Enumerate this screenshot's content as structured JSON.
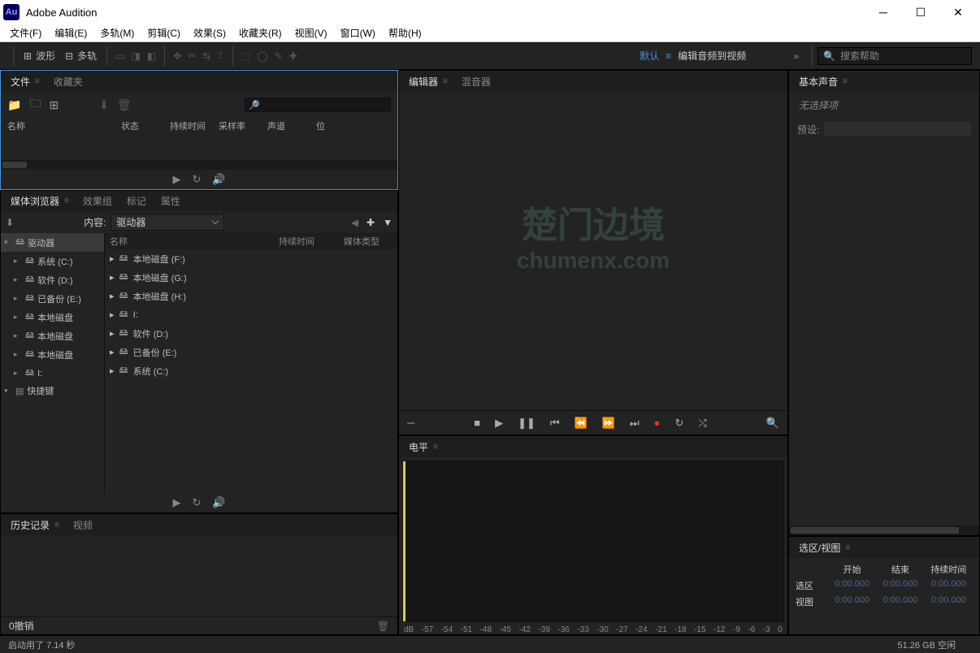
{
  "app": {
    "title": "Adobe Audition",
    "logo": "Au"
  },
  "menu": [
    "文件(F)",
    "编辑(E)",
    "多轨(M)",
    "剪辑(C)",
    "效果(S)",
    "收藏夹(R)",
    "视图(V)",
    "窗口(W)",
    "帮助(H)"
  ],
  "toolbar": {
    "waveform": "波形",
    "multitrack": "多轨",
    "workspace_default": "默认",
    "workspace_editVideo": "编辑音频到视频"
  },
  "search": {
    "placeholder": "搜索帮助"
  },
  "filesPanel": {
    "tabs": {
      "files": "文件",
      "favorites": "收藏夹"
    },
    "cols": {
      "name": "名称",
      "status": "状态",
      "duration": "持续时间",
      "sampleRate": "采样率",
      "channels": "声道",
      "bit": "位"
    }
  },
  "mediaBrowser": {
    "tabs": {
      "mediaBrowser": "媒体浏览器",
      "effectsRack": "效果组",
      "markers": "标记",
      "properties": "属性"
    },
    "contentLabel": "内容:",
    "contentValue": "驱动器",
    "treeHdr": "名称",
    "listHdr": {
      "duration": "持续时间",
      "mediaType": "媒体类型"
    },
    "treeRoot": "驱动器",
    "treeNodes": [
      "系统 (C:)",
      "软件 (D:)",
      "已备份 (E:)",
      "本地磁盘",
      "本地磁盘",
      "本地磁盘",
      "I:"
    ],
    "treeShortcuts": "快捷键",
    "listItems": [
      "本地磁盘 (F:)",
      "本地磁盘 (G:)",
      "本地磁盘 (H:)",
      "I:",
      "软件 (D:)",
      "已备份 (E:)",
      "系统 (C:)"
    ]
  },
  "history": {
    "tab": "历史记录",
    "video": "视频",
    "undoCount": "0撤销"
  },
  "editor": {
    "tab": "编辑器",
    "mixer": "混音器"
  },
  "levels": {
    "tab": "电平",
    "dbScale": [
      "dB",
      "-57",
      "-54",
      "-51",
      "-48",
      "-45",
      "-42",
      "-39",
      "-36",
      "-33",
      "-30",
      "-27",
      "-24",
      "-21",
      "-18",
      "-15",
      "-12",
      "-9",
      "-6",
      "-3",
      "0"
    ]
  },
  "essentialSound": {
    "tab": "基本声音",
    "noSelection": "无选择项",
    "presetLabel": "预设:"
  },
  "selectionView": {
    "tab": "选区/视图",
    "cols": {
      "start": "开始",
      "end": "结束",
      "duration": "持续时间"
    },
    "rows": {
      "selection": "选区",
      "view": "视图"
    },
    "zeroTime": "0:00.000"
  },
  "status": {
    "startup": "启动用了 7.14 秒",
    "disk": "51.26 GB 空闲"
  },
  "watermark": {
    "big": "楚门边境",
    "sub": "chumenx.com"
  }
}
